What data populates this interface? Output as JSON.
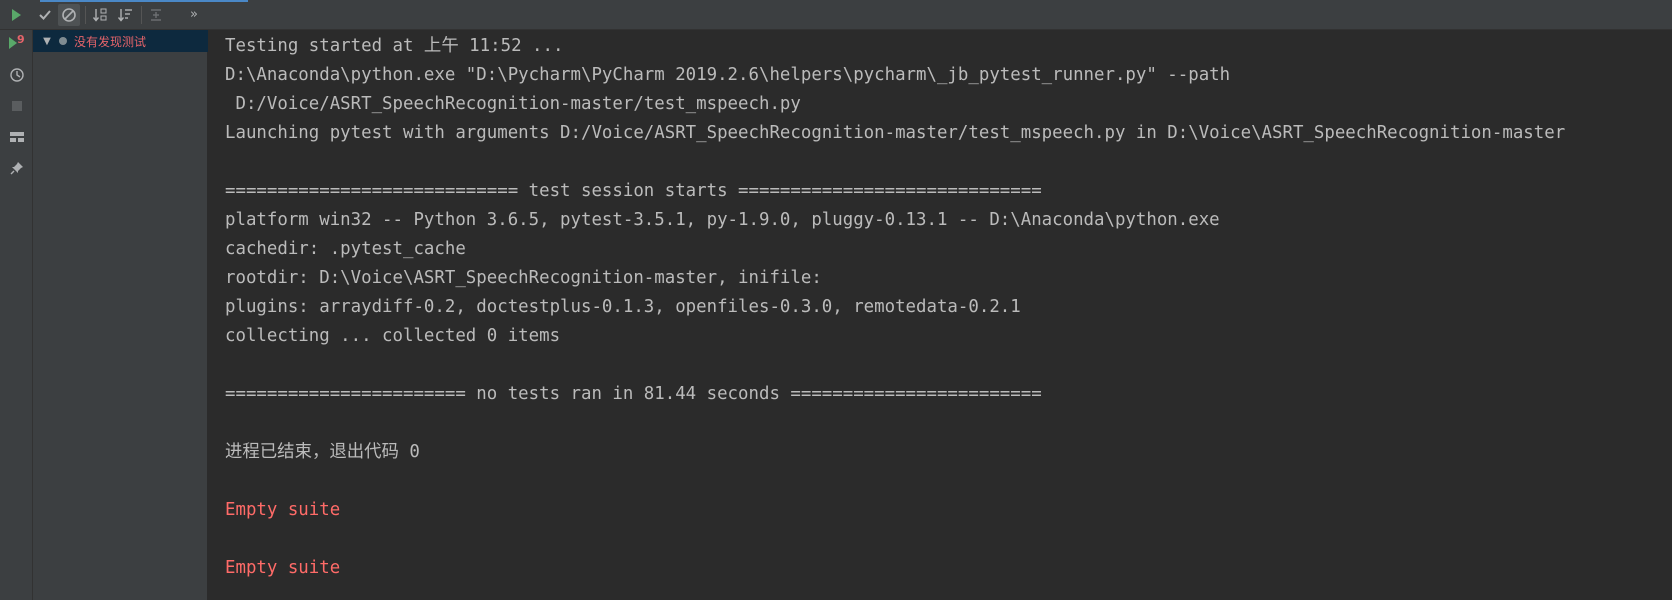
{
  "toolbar": {
    "buttons": [
      {
        "name": "rerun-icon",
        "tooltip": ""
      },
      {
        "name": "show-passed-icon"
      },
      {
        "name": "show-ignored-icon"
      },
      {
        "name": "sort-alphabetically-icon"
      },
      {
        "name": "sort-by-duration-icon"
      },
      {
        "name": "expand-all-icon"
      }
    ],
    "more_label": "»"
  },
  "side_toolbar": {
    "rerun_failed_badge": "9"
  },
  "tree": {
    "root_label": "没有发现测试"
  },
  "console": {
    "lines": [
      {
        "text": "Testing started at 上午 11:52 ...",
        "kind": "normal"
      },
      {
        "text": "D:\\Anaconda\\python.exe \"D:\\Pycharm\\PyCharm 2019.2.6\\helpers\\pycharm\\_jb_pytest_runner.py\" --path",
        "kind": "normal"
      },
      {
        "text": " D:/Voice/ASRT_SpeechRecognition-master/test_mspeech.py",
        "kind": "normal"
      },
      {
        "text": "Launching pytest with arguments D:/Voice/ASRT_SpeechRecognition-master/test_mspeech.py in D:\\Voice\\ASRT_SpeechRecognition-master",
        "kind": "normal"
      },
      {
        "text": "",
        "kind": "blank"
      },
      {
        "text": "============================ test session starts =============================",
        "kind": "normal"
      },
      {
        "text": "platform win32 -- Python 3.6.5, pytest-3.5.1, py-1.9.0, pluggy-0.13.1 -- D:\\Anaconda\\python.exe",
        "kind": "normal"
      },
      {
        "text": "cachedir: .pytest_cache",
        "kind": "normal"
      },
      {
        "text": "rootdir: D:\\Voice\\ASRT_SpeechRecognition-master, inifile:",
        "kind": "normal"
      },
      {
        "text": "plugins: arraydiff-0.2, doctestplus-0.1.3, openfiles-0.3.0, remotedata-0.2.1",
        "kind": "normal"
      },
      {
        "text": "collecting ... collected 0 items",
        "kind": "normal"
      },
      {
        "text": "",
        "kind": "blank"
      },
      {
        "text": "======================= no tests ran in 81.44 seconds ========================",
        "kind": "normal"
      },
      {
        "text": "",
        "kind": "blank"
      },
      {
        "text": "进程已结束，退出代码 0",
        "kind": "normal"
      },
      {
        "text": "",
        "kind": "blank"
      },
      {
        "text": "Empty suite",
        "kind": "err"
      },
      {
        "text": "",
        "kind": "blank"
      },
      {
        "text": "Empty suite",
        "kind": "err"
      }
    ]
  },
  "colors": {
    "background": "#2b2b2b",
    "panel": "#3c3f41",
    "console_text": "#bbbbbb",
    "error_text": "#ff6b68",
    "tree_selection": "#0d293e",
    "run_green": "#59a869"
  }
}
